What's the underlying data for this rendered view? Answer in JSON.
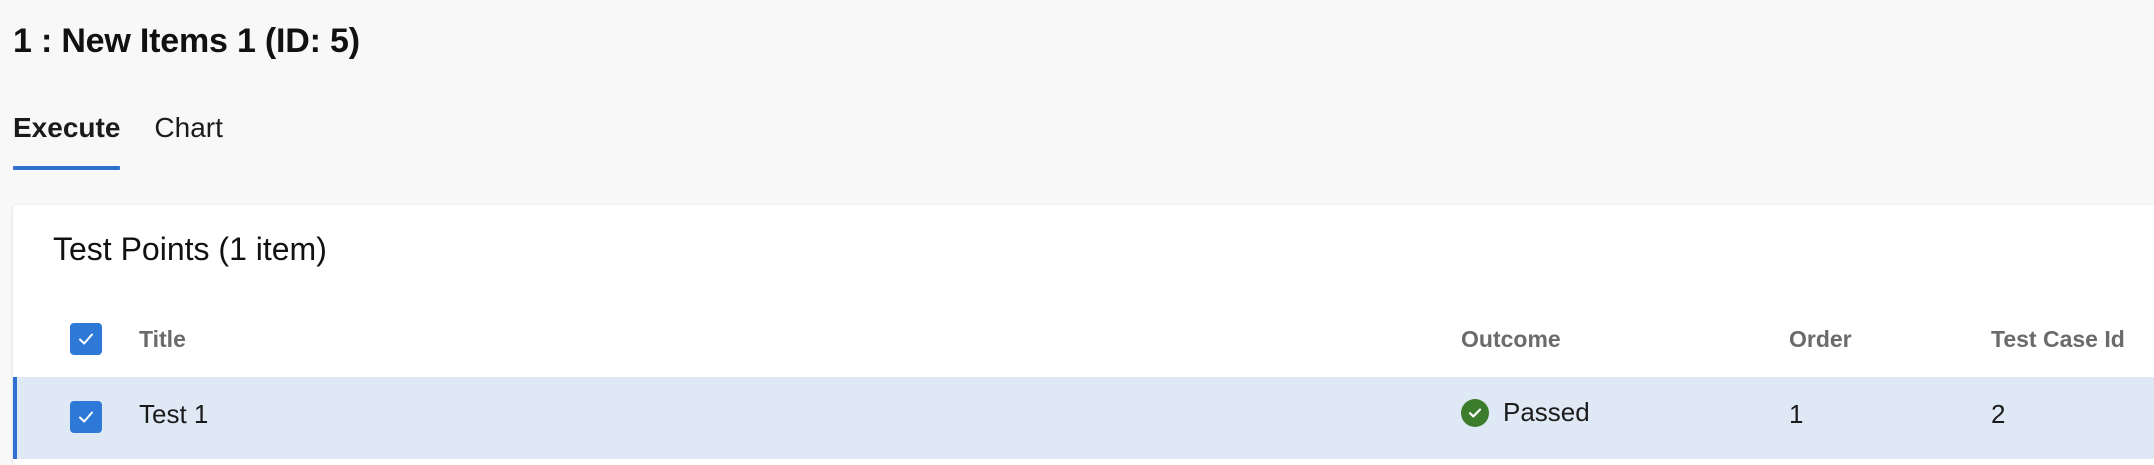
{
  "page": {
    "title": "1 : New Items 1 (ID: 5)"
  },
  "tabs": [
    {
      "label": "Execute",
      "active": true
    },
    {
      "label": "Chart",
      "active": false
    }
  ],
  "panel": {
    "title": "Test Points (1 item)",
    "columns": {
      "title": "Title",
      "outcome": "Outcome",
      "order": "Order",
      "test_case_id": "Test Case Id"
    },
    "header_checkbox_checked": true,
    "rows": [
      {
        "selected": true,
        "checked": true,
        "title": "Test 1",
        "outcome": "Passed",
        "outcome_icon": "check-circle-icon",
        "order": "1",
        "test_case_id": "2"
      }
    ]
  },
  "colors": {
    "accent": "#2e6fd0",
    "checkbox": "#2e78d8",
    "selected_row": "#dfe9f6",
    "passed": "#3b7d2c",
    "header_text": "#6b6b6b"
  }
}
